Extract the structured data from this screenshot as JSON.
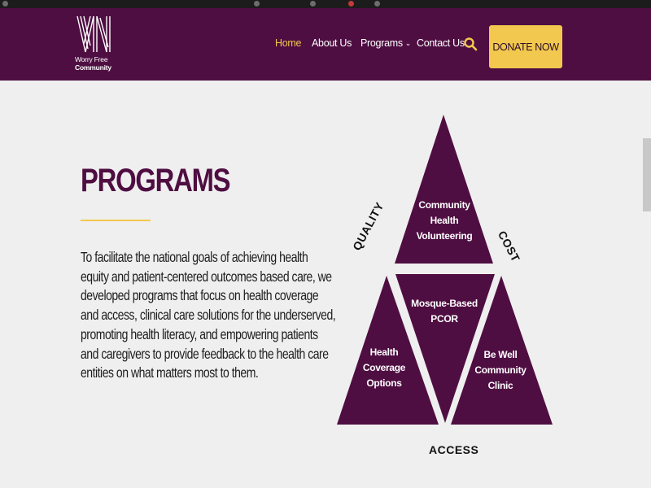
{
  "brand": {
    "logo_line1": "Worry Free",
    "logo_line2": "Community"
  },
  "nav": {
    "items": [
      {
        "label": "Home",
        "active": true
      },
      {
        "label": "About Us"
      },
      {
        "label": "Programs",
        "has_dropdown": true
      },
      {
        "label": "Contact Us"
      }
    ],
    "search_icon": "search-icon",
    "donate_label": "DONATE NOW"
  },
  "programs": {
    "title": "PROGRAMS",
    "body_lines": [
      "To facilitate the national goals of achieving health",
      "equity and patient-centered outcomes based care, we",
      "developed programs that focus on health coverage",
      "and access, clinical care solutions for the underserved,",
      "promoting health literacy, and empowering patients",
      "and caregivers to provide feedback to the health care",
      "entities on what matters most to them."
    ]
  },
  "diagram": {
    "top": [
      "Community",
      "Health",
      "Volunteering"
    ],
    "center": [
      "Mosque-Based",
      "PCOR"
    ],
    "left": [
      "Health",
      "Coverage",
      "Options"
    ],
    "right": [
      "Be Well",
      "Community",
      "Clinic"
    ],
    "label_left": "QUALITY",
    "label_right": "COST",
    "label_bottom": "ACCESS"
  },
  "colors": {
    "brand_purple": "#4f0e42",
    "accent_yellow": "#f2c84e",
    "background": "#efefef"
  }
}
